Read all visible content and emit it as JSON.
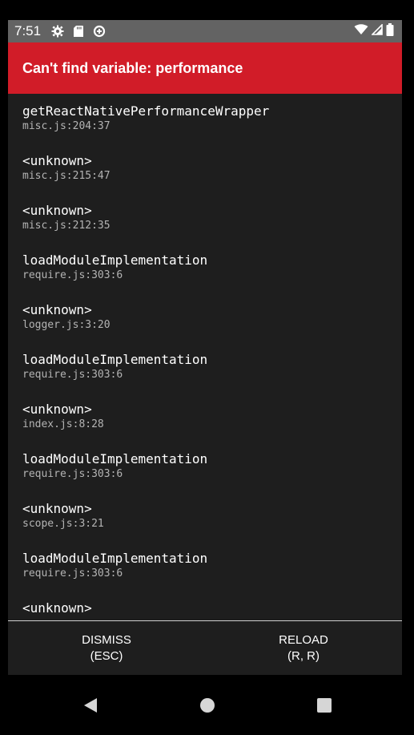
{
  "status_bar": {
    "time": "7:51",
    "left_icons": [
      "gear-icon",
      "sd-card-icon",
      "data-saver-icon"
    ],
    "right_icons": [
      "wifi-icon",
      "cell-signal-icon",
      "battery-icon"
    ]
  },
  "error": {
    "title": "Can't find variable: performance"
  },
  "stack": [
    {
      "method": "getReactNativePerformanceWrapper",
      "location": "misc.js:204:37"
    },
    {
      "method": "<unknown>",
      "location": "misc.js:215:47"
    },
    {
      "method": "<unknown>",
      "location": "misc.js:212:35"
    },
    {
      "method": "loadModuleImplementation",
      "location": "require.js:303:6"
    },
    {
      "method": "<unknown>",
      "location": "logger.js:3:20"
    },
    {
      "method": "loadModuleImplementation",
      "location": "require.js:303:6"
    },
    {
      "method": "<unknown>",
      "location": "index.js:8:28"
    },
    {
      "method": "loadModuleImplementation",
      "location": "require.js:303:6"
    },
    {
      "method": "<unknown>",
      "location": "scope.js:3:21"
    },
    {
      "method": "loadModuleImplementation",
      "location": "require.js:303:6"
    },
    {
      "method": "<unknown>",
      "location": ""
    }
  ],
  "footer": {
    "dismiss_label": "DISMISS",
    "dismiss_shortcut": "(ESC)",
    "reload_label": "RELOAD",
    "reload_shortcut": "(R, R)"
  },
  "nav": {
    "icons": [
      "back-icon",
      "home-icon",
      "recents-icon"
    ]
  },
  "colors": {
    "error_red": "#d11c28",
    "background": "#1e1e1e",
    "status_bar": "#636363"
  }
}
